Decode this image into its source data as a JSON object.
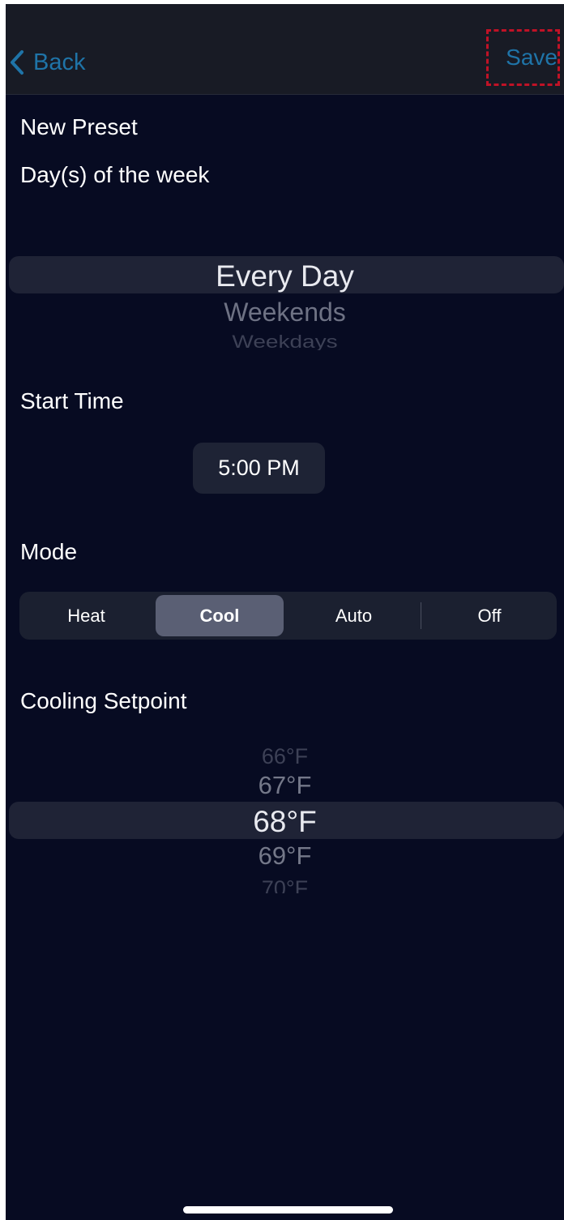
{
  "nav": {
    "back_label": "Back",
    "save_label": "Save"
  },
  "title": "New Preset",
  "days": {
    "label": "Day(s) of the week",
    "options": [
      "Every Day",
      "Weekends",
      "Weekdays"
    ],
    "selected": "Every Day"
  },
  "start_time": {
    "label": "Start Time",
    "value": "5:00 PM"
  },
  "mode": {
    "label": "Mode",
    "options": [
      "Heat",
      "Cool",
      "Auto",
      "Off"
    ],
    "selected": "Cool"
  },
  "setpoint": {
    "label": "Cooling Setpoint",
    "options": [
      "66°F",
      "67°F",
      "68°F",
      "69°F",
      "70°F"
    ],
    "selected": "68°F"
  },
  "colors": {
    "background": "#070b22",
    "navbar": "#181b25",
    "accent": "#1f74a8",
    "highlight_border": "#c01226",
    "segment_selected": "#5a5f74"
  },
  "icons": {
    "back": "chevron-left-icon"
  }
}
